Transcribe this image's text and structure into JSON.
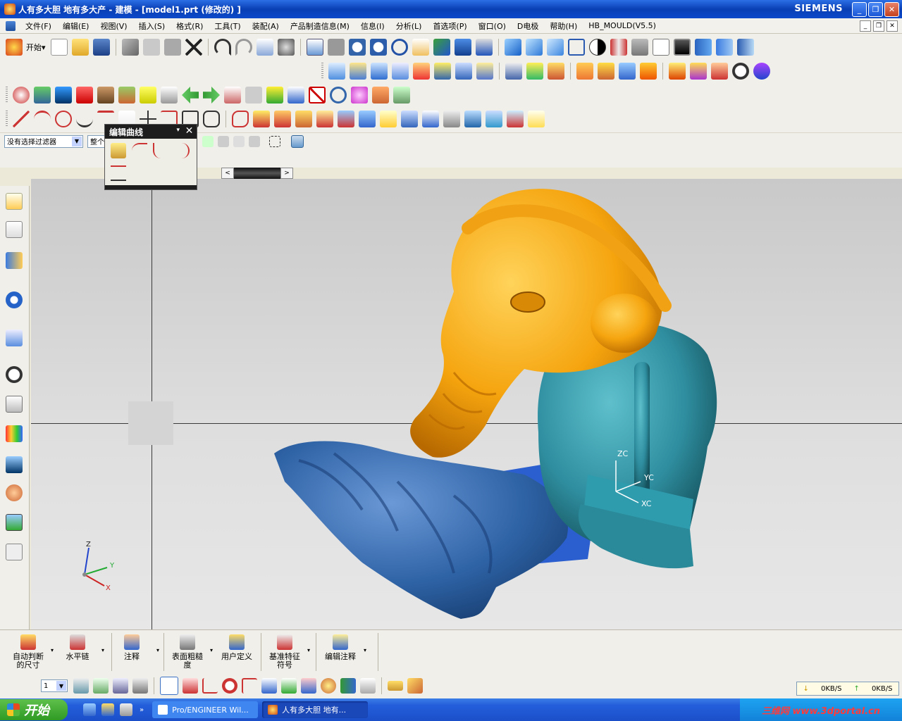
{
  "window": {
    "title": "人有多大胆 地有多大产 - 建模 - [model1.prt (修改的) ]",
    "brand": "SIEMENS",
    "minimize": "_",
    "maximize": "❐",
    "close": "✕"
  },
  "menu": [
    "文件(F)",
    "编辑(E)",
    "视图(V)",
    "插入(S)",
    "格式(R)",
    "工具(T)",
    "装配(A)",
    "产品制造信息(M)",
    "信息(I)",
    "分析(L)",
    "首选项(P)",
    "窗口(O)",
    "D电极",
    "帮助(H)",
    "HB_MOULD(V5.5)"
  ],
  "toolbar": {
    "start_label": "开始",
    "start_arrow": "▾"
  },
  "selection": {
    "filter": "没有选择过滤器",
    "scope": "整个"
  },
  "palette": {
    "title": "编辑曲线",
    "close": "✕",
    "dropdown": "▾"
  },
  "slider": {
    "left": "<",
    "right": ">"
  },
  "annotation_toolbar": [
    {
      "label1": "自动判断",
      "label2": "的尺寸"
    },
    {
      "label1": "水平链",
      "label2": ""
    },
    {
      "label1": "注释",
      "label2": ""
    },
    {
      "label1": "表面粗糙",
      "label2": "度"
    },
    {
      "label1": "用户定义",
      "label2": ""
    },
    {
      "label1": "基准特征",
      "label2": "符号"
    },
    {
      "label1": "编辑注释",
      "label2": ""
    }
  ],
  "snap": {
    "layer": "1"
  },
  "axes": {
    "triad": {
      "z": "Z",
      "y": "Y",
      "x": "X"
    },
    "wcs": {
      "z": "ZC",
      "y": "YC",
      "x": "XC"
    }
  },
  "netmon": {
    "down": "0KB/S",
    "up": "0KB/S"
  },
  "taskbar": {
    "start": "开始",
    "tasks": [
      "Pro/ENGINEER Wil...",
      "人有多大胆 地有..."
    ],
    "watermark": "三维网 www.3dportal.cn"
  },
  "colors": {
    "head": "#f5a40e",
    "body": "#2f8fa0",
    "base": "#2e63a6",
    "titlebar": "#0a3fb5"
  }
}
